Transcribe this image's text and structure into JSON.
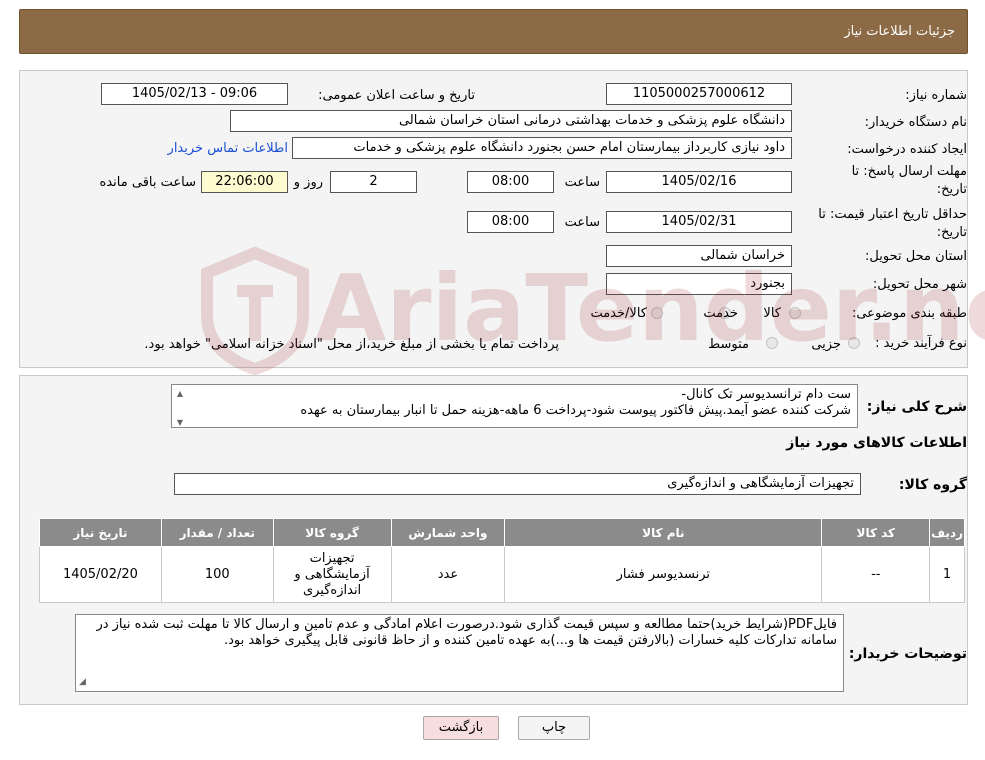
{
  "header": {
    "title": "جزئیات اطلاعات نیاز"
  },
  "fields": {
    "need_number_label": "شماره نیاز:",
    "need_number": "1105000257000612",
    "announce_label": "تاریخ و ساعت اعلان عمومی:",
    "announce_value": "1405/02/13 - 09:06",
    "buyer_org_label": "نام دستگاه خریدار:",
    "buyer_org": "دانشگاه علوم پزشکی و خدمات بهداشتی درمانی استان خراسان شمالی",
    "creator_label": "ایجاد کننده درخواست:",
    "creator": "داود نیازی کاربرداز بیمارستان امام حسن بجنورد دانشگاه علوم پزشکی و خدمات",
    "contact_link": "اطلاعات تماس خریدار",
    "send_deadline_label_1": "مهلت ارسال پاسخ: تا",
    "send_deadline_label_2": "تاریخ:",
    "send_date": "1405/02/16",
    "time_label": "ساعت",
    "send_time": "08:00",
    "days_value": "2",
    "days_label": "روز و",
    "remaining_time": "22:06:00",
    "remaining_label": "ساعت باقی مانده",
    "validity_label_1": "حداقل تاریخ اعتبار قیمت: تا",
    "validity_label_2": "تاریخ:",
    "validity_date": "1405/02/31",
    "validity_time": "08:00",
    "province_label": "استان محل تحویل:",
    "province": "خراسان شمالی",
    "city_label": "شهر محل تحویل:",
    "city": "بجنورد",
    "category_label": "طبقه بندی موضوعی:",
    "category_options": [
      "کالا",
      "خدمت",
      "کالا/خدمت"
    ],
    "process_label": "نوع فرآیند خرید :",
    "process_options": [
      "جزیی",
      "متوسط"
    ],
    "process_note": "پرداخت تمام یا بخشی از مبلغ خرید،از محل \"اسناد خزانه اسلامی\" خواهد بود."
  },
  "summary": {
    "label": "شرح کلی نیاز:",
    "line1": "ست دام ترانسدیوسر تک کانال-",
    "line2": "شرکت کننده عضو آیمد.پیش فاکتور پیوست  شود-پرداخت 6 ماهه-هزینه حمل تا انبار بیمارستان به عهده"
  },
  "goods_section_title": "اطلاعات کالاهای مورد نیاز",
  "goods_group": {
    "label": "گروه کالا:",
    "value": "تجهیزات آزمایشگاهی و اندازه‌گیری"
  },
  "table": {
    "headers": [
      "ردیف",
      "کد کالا",
      "نام کالا",
      "واحد شمارش",
      "گروه کالا",
      "تعداد / مقدار",
      "تاریخ نیاز"
    ],
    "rows": [
      {
        "row": "1",
        "code": "--",
        "name": "ترنسدیوسر فشار",
        "unit": "عدد",
        "group": "تجهیزات آزمایشگاهی و اندازه‌گیری",
        "qty": "100",
        "date": "1405/02/20"
      }
    ]
  },
  "buyer_notes": {
    "label": "توضیحات خریدار:",
    "text": "فایلPDF(شرایط خرید)حتما مطالعه و سپس قیمت گذاری شود.درصورت اعلام امادگی و عدم تامین و ارسال کالا تا مهلت ثبت شده نیاز در سامانه تدارکات کلیه خسارات (بالارفتن قیمت ها و...)به عهده تامین کننده و از حاظ قانونی قابل پیگیری خواهد بود."
  },
  "buttons": {
    "print": "چاپ",
    "back": "بازگشت"
  },
  "watermark_text": "AriaTender.neT",
  "colors": {
    "header_bg": "#8b6a45",
    "table_header_bg": "#8b8b8b",
    "back_btn_bg": "#f7dede",
    "link": "#1a4fd6"
  }
}
